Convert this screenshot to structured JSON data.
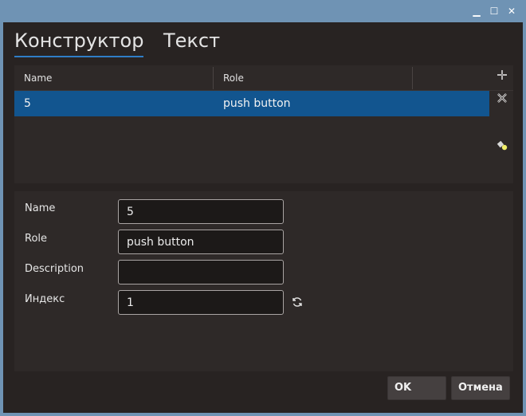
{
  "window": {
    "controls": [
      "minimize-icon",
      "maximize-icon",
      "close-icon"
    ]
  },
  "tabs": [
    {
      "label": "Конструктор",
      "active": true
    },
    {
      "label": "Текст",
      "active": false
    }
  ],
  "grid": {
    "columns": [
      "Name",
      "Role"
    ],
    "rows": [
      {
        "name": "5",
        "role": "push button",
        "selected": true
      }
    ]
  },
  "tools": [
    "add-icon",
    "delete-icon",
    "highlight-icon"
  ],
  "form": {
    "name": {
      "label": "Name",
      "value": "5"
    },
    "role": {
      "label": "Role",
      "value": "push button"
    },
    "description": {
      "label": "Description",
      "value": ""
    },
    "index": {
      "label": "Индекс",
      "value": "1"
    }
  },
  "buttons": {
    "ok": "OK",
    "cancel": "Отмена"
  },
  "colors": {
    "accent": "#2f7dc6",
    "selection": "#12558f",
    "titlebar": "#6f93b4"
  }
}
